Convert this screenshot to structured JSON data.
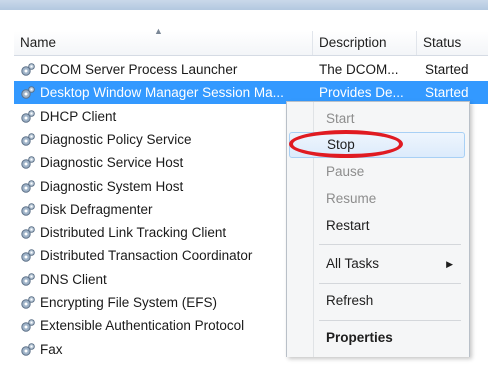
{
  "columns": {
    "name": "Name",
    "description": "Description",
    "status": "Status"
  },
  "rows": [
    {
      "name": "DCOM Server Process Launcher",
      "description": "The DCOM...",
      "status": "Started"
    },
    {
      "name": "Desktop Window Manager Session Ma...",
      "description": "Provides De...",
      "status": "Started",
      "selected": true
    },
    {
      "name": "DHCP Client",
      "description": "",
      "status": ""
    },
    {
      "name": "Diagnostic Policy Service",
      "description": "",
      "status": ""
    },
    {
      "name": "Diagnostic Service Host",
      "description": "",
      "status": ""
    },
    {
      "name": "Diagnostic System Host",
      "description": "",
      "status": ""
    },
    {
      "name": "Disk Defragmenter",
      "description": "",
      "status": ""
    },
    {
      "name": "Distributed Link Tracking Client",
      "description": "",
      "status": ""
    },
    {
      "name": "Distributed Transaction Coordinator",
      "description": "",
      "status": ""
    },
    {
      "name": "DNS Client",
      "description": "",
      "status": ""
    },
    {
      "name": "Encrypting File System (EFS)",
      "description": "",
      "status": ""
    },
    {
      "name": "Extensible Authentication Protocol",
      "description": "",
      "status": ""
    },
    {
      "name": "Fax",
      "description": "",
      "status": ""
    }
  ],
  "context_menu": {
    "items": [
      {
        "label": "Start",
        "enabled": false
      },
      {
        "label": "Stop",
        "enabled": true,
        "highlighted": true
      },
      {
        "label": "Pause",
        "enabled": false
      },
      {
        "label": "Resume",
        "enabled": false
      },
      {
        "label": "Restart",
        "enabled": true
      },
      {
        "label": "All Tasks",
        "enabled": true,
        "submenu": true
      },
      {
        "label": "Refresh",
        "enabled": true
      },
      {
        "label": "Properties",
        "enabled": true,
        "bold": true
      }
    ]
  },
  "icons": {
    "service": "gear-icon",
    "sort": "sort-ascending-icon",
    "submenu": "submenu-arrow-icon"
  },
  "colors": {
    "selection": "#3399ff",
    "annotation_ring": "#e01b22"
  }
}
